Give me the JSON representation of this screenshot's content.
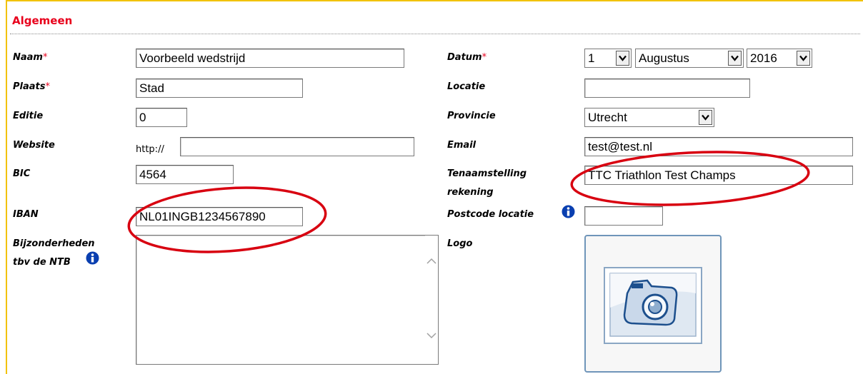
{
  "section": {
    "title": "Algemeen"
  },
  "required_marker": "*",
  "left": {
    "naam": {
      "label": "Naam",
      "value": "Voorbeeld wedstrijd"
    },
    "plaats": {
      "label": "Plaats",
      "value": "Stad"
    },
    "editie": {
      "label": "Editie",
      "value": "0"
    },
    "website": {
      "label": "Website",
      "prefix": "http://",
      "value": ""
    },
    "bic": {
      "label": "BIC",
      "value": "4564"
    },
    "iban": {
      "label": "IBAN",
      "value": "NL01INGB1234567890"
    },
    "bijzonderheden": {
      "label_line1": "Bijzonderheden",
      "label_line2": "tbv de NTB",
      "value": ""
    }
  },
  "right": {
    "datum": {
      "label": "Datum",
      "day": "1",
      "month": "Augustus",
      "year": "2016"
    },
    "locatie": {
      "label": "Locatie",
      "value": ""
    },
    "provincie": {
      "label": "Provincie",
      "value": "Utrecht"
    },
    "email": {
      "label": "Email",
      "value": "test@test.nl"
    },
    "tenaamstelling": {
      "label_line1": "Tenaamstelling",
      "label_line2": "rekening",
      "value": "TTC Triathlon Test Champs"
    },
    "postcode": {
      "label": "Postcode locatie",
      "value": ""
    },
    "logo": {
      "label": "Logo"
    }
  },
  "colors": {
    "accent_red": "#e8001c",
    "frame_yellow": "#f2c200",
    "annotation_red": "#d80010",
    "info_blue": "#0a3fb0"
  },
  "icons": {
    "info": "info-icon",
    "dropdown": "chevron-down-icon",
    "logo": "camera-icon"
  }
}
